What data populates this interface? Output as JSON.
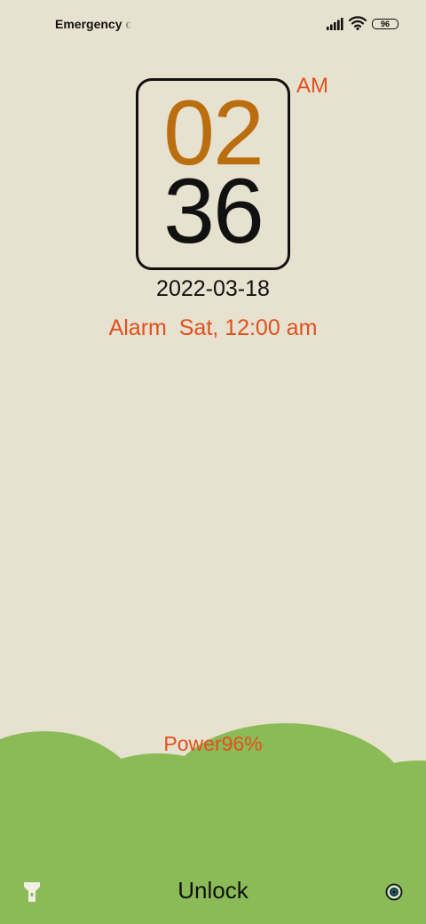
{
  "status_bar": {
    "carrier": "Emergency calls only",
    "battery_level": "96",
    "icons": [
      "signal-icon",
      "wifi-icon",
      "battery-icon"
    ]
  },
  "clock": {
    "hour": "02",
    "minute": "36",
    "ampm": "AM",
    "date": "2022-03-18"
  },
  "alarm": {
    "text": "Alarm  Sat, 12:00 am"
  },
  "power": {
    "text": "Power96%"
  },
  "bottom": {
    "unlock_label": "Unlock",
    "left_icon": "flashlight-icon",
    "right_icon": "camera-icon"
  },
  "colors": {
    "background": "#e6e2cf",
    "hills": "#8bbb57",
    "accent": "#e2501e",
    "hour": "#bb6e10"
  }
}
